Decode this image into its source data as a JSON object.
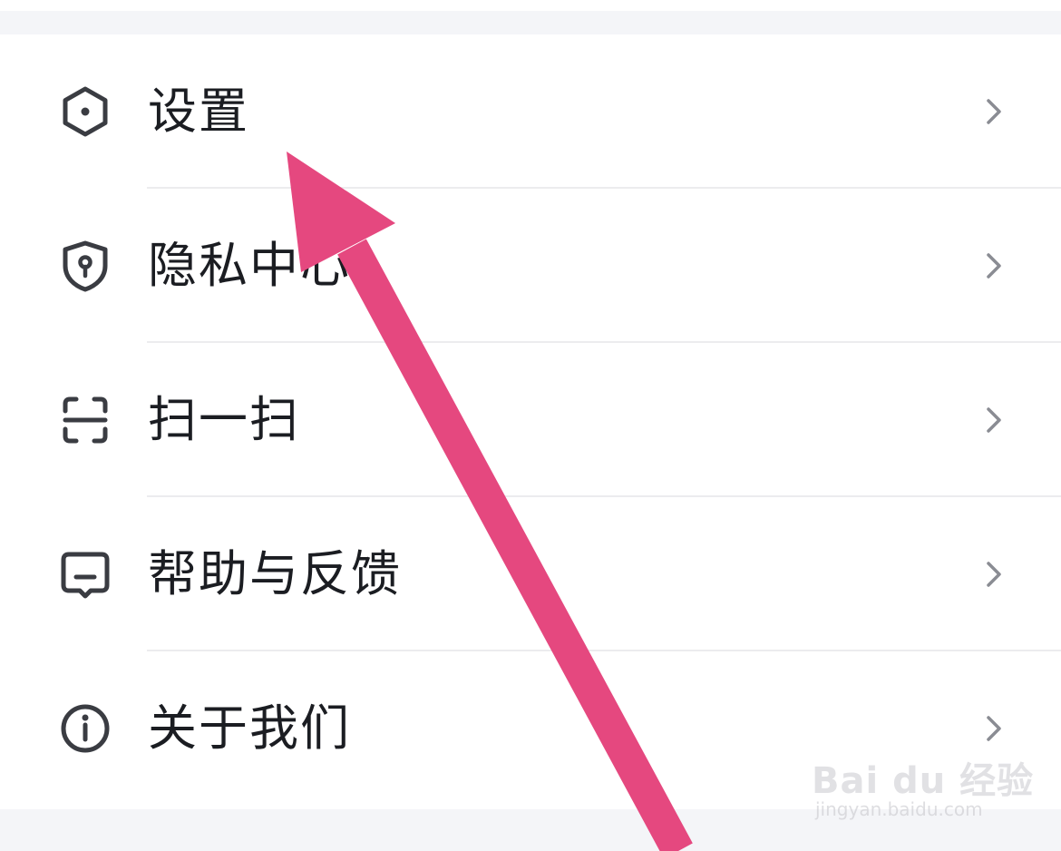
{
  "menu": {
    "items": [
      {
        "label": "设置",
        "icon": "settings-hexagon-icon"
      },
      {
        "label": "隐私中心",
        "icon": "privacy-shield-icon"
      },
      {
        "label": "扫一扫",
        "icon": "scan-icon"
      },
      {
        "label": "帮助与反馈",
        "icon": "help-feedback-icon"
      },
      {
        "label": "关于我们",
        "icon": "info-circle-icon"
      }
    ],
    "chevron_icon": "chevron-right-icon"
  },
  "annotation": {
    "arrow_color": "#e5487f"
  },
  "watermark": {
    "logo": "Bai du 经验",
    "url": "jingyan.baidu.com"
  },
  "colors": {
    "text": "#1b1d22",
    "icon": "#3a3c42",
    "chevron": "#8a8c93",
    "divider": "#ececee",
    "background_strip": "#f4f5f8"
  }
}
